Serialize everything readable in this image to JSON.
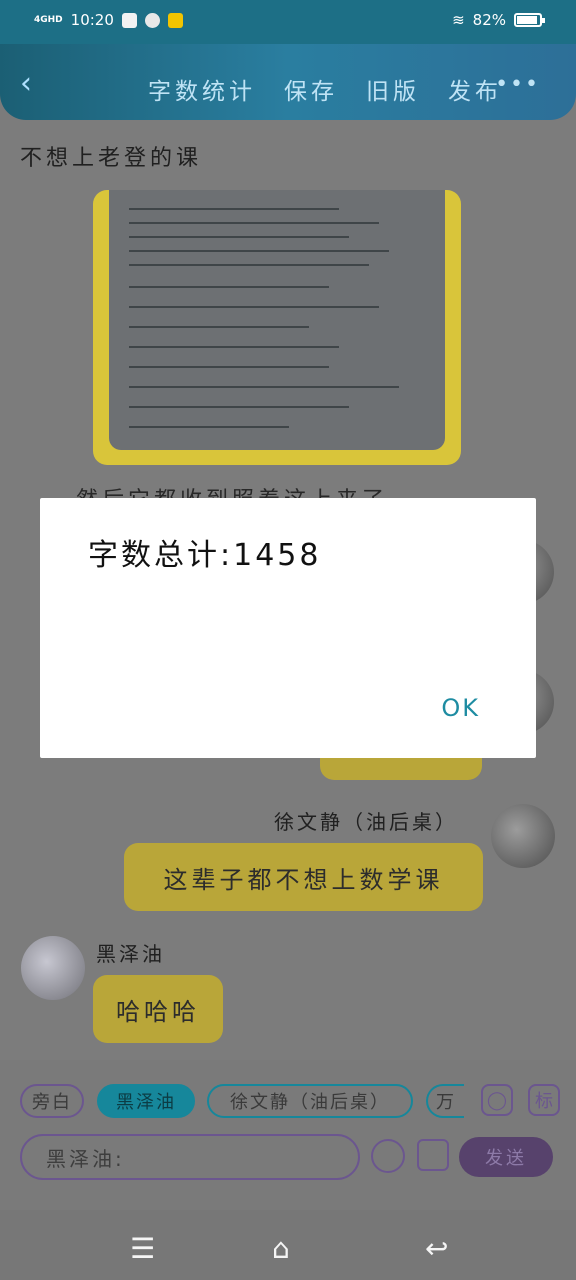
{
  "status": {
    "signal": "4GHD",
    "time": "10:20",
    "battery_pct": "82%",
    "battery_level": 0.82
  },
  "header": {
    "back_icon": "chevron-left-icon",
    "nav": [
      "字数统计",
      "保存",
      "旧版",
      "发布"
    ],
    "more": "•••"
  },
  "chat": {
    "first_text": "不想上老登的课",
    "partial_text": "然后它都收到照着这上来了",
    "messages": [
      {
        "name": "徐文静（油后桌）",
        "text": "这辈子都不想上数学课"
      },
      {
        "name": "黑泽油",
        "text": "哈哈哈"
      }
    ]
  },
  "dialog": {
    "text": "字数总计:1458",
    "ok": "OK"
  },
  "input": {
    "chips": [
      "旁白",
      "黑泽油",
      "徐文静（油后桌）",
      "万"
    ],
    "icons": [
      "person-icon",
      "标"
    ],
    "placeholder": "黑泽油:",
    "send": "发送"
  },
  "navbar": {
    "menu_icon": "☰",
    "home_icon": "⌂",
    "back_icon": "↩"
  }
}
